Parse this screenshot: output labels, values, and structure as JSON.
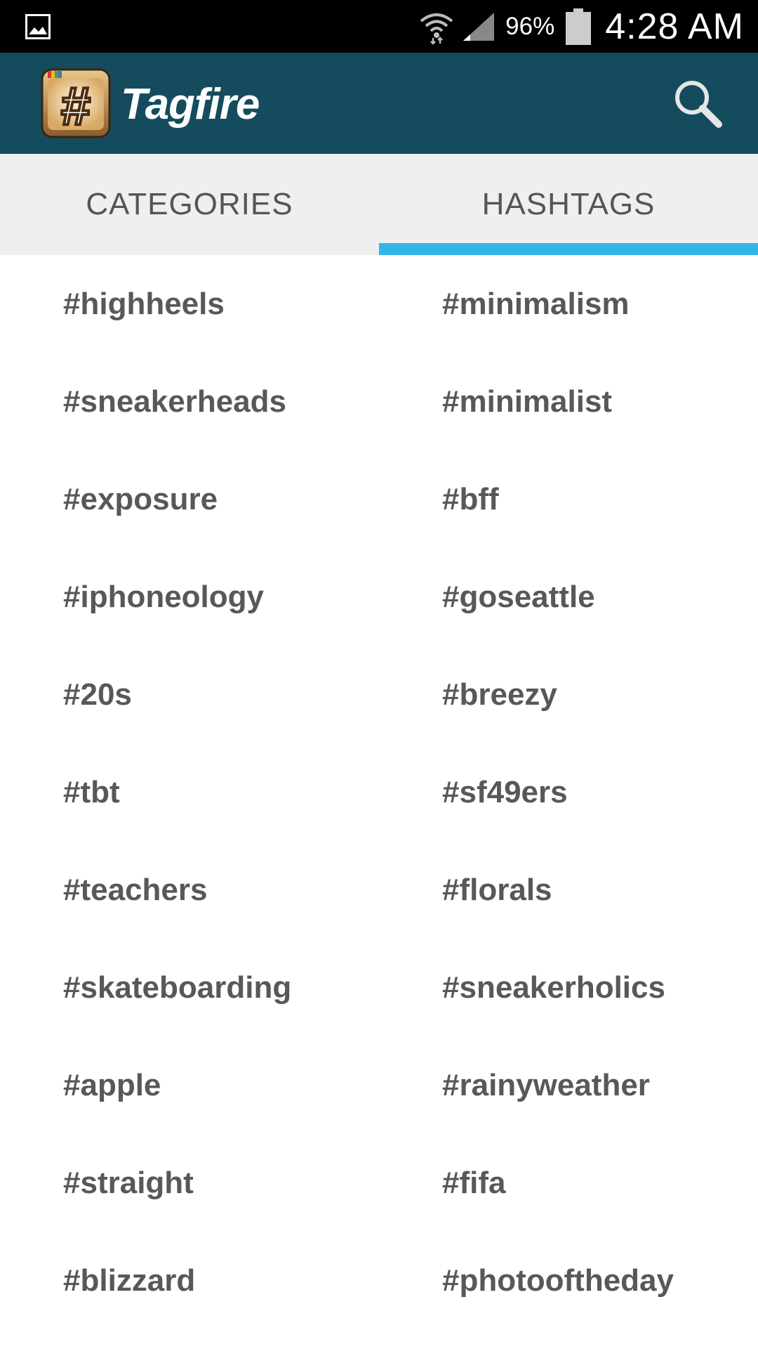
{
  "status_bar": {
    "left_icon": "image-icon",
    "wifi_icon": "wifi-icon",
    "signal_icon": "signal-icon",
    "battery_percent": "96%",
    "battery_icon": "battery-icon",
    "time": "4:28 AM"
  },
  "action_bar": {
    "title": "Tagfire",
    "logo_icon": "hashtag-logo-icon",
    "search_icon": "search-icon",
    "background_color": "#144c5e"
  },
  "tabs": [
    {
      "label": "CATEGORIES",
      "selected": false
    },
    {
      "label": "HASHTAGS",
      "selected": true
    }
  ],
  "tab_indicator_color": "#33b5e5",
  "hashtags": {
    "left_column": [
      "#highheels",
      "#sneakerheads",
      "#exposure",
      "#iphoneology",
      "#20s",
      "#tbt",
      "#teachers",
      "#skateboarding",
      "#apple",
      "#straight",
      "#blizzard"
    ],
    "right_column": [
      "#minimalism",
      "#minimalist",
      "#bff",
      "#goseattle",
      "#breezy",
      "#sf49ers",
      "#florals",
      "#sneakerholics",
      "#rainyweather",
      "#fifa",
      "#photooftheday"
    ]
  }
}
